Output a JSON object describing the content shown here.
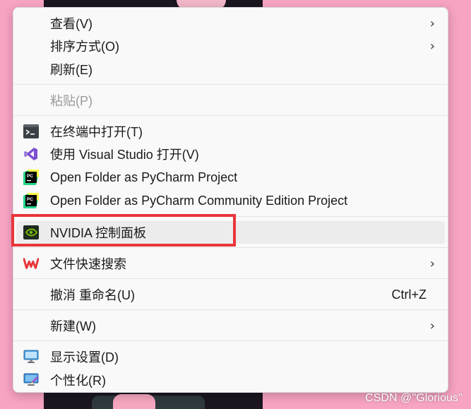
{
  "menu": {
    "items": [
      {
        "label": "查看(V)",
        "submenu": true
      },
      {
        "label": "排序方式(O)",
        "submenu": true
      },
      {
        "label": "刷新(E)"
      },
      {
        "label": "粘贴(P)",
        "disabled": true
      },
      {
        "label": "在终端中打开(T)",
        "icon": "terminal-icon"
      },
      {
        "label": "使用 Visual Studio 打开(V)",
        "icon": "visual-studio-icon"
      },
      {
        "label": "Open Folder as PyCharm Project",
        "icon": "pycharm-icon"
      },
      {
        "label": "Open Folder as PyCharm Community Edition Project",
        "icon": "pycharm-community-icon"
      },
      {
        "label": "NVIDIA 控制面板",
        "icon": "nvidia-icon",
        "hovered": true
      },
      {
        "label": "文件快速搜索",
        "icon": "wps-icon",
        "submenu": true
      },
      {
        "label": "撤消 重命名(U)",
        "shortcut": "Ctrl+Z"
      },
      {
        "label": "新建(W)",
        "submenu": true
      },
      {
        "label": "显示设置(D)",
        "icon": "display-icon"
      },
      {
        "label": "个性化(R)",
        "icon": "personalize-icon"
      }
    ],
    "submenu_arrow": "›"
  },
  "watermark": "CSDN @''Glorious''",
  "colors": {
    "highlight_box": "#e8363a",
    "menu_bg": "#f9f9f9",
    "hover_bg": "#ececec",
    "disabled_text": "#9a9a9a",
    "background": "#f7a3c3"
  }
}
